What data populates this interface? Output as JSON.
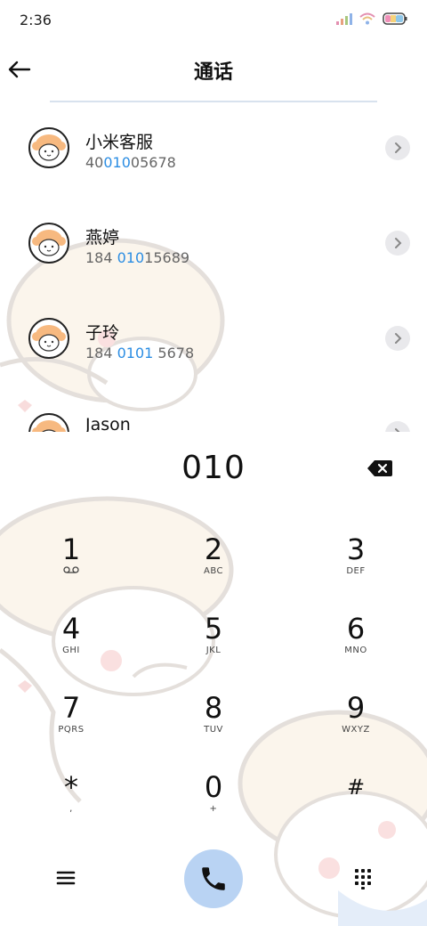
{
  "status_bar": {
    "time": "2:36"
  },
  "header": {
    "title": "通话"
  },
  "contacts": [
    {
      "name": "小米客服",
      "number_parts": [
        "40",
        "010",
        "05678"
      ]
    },
    {
      "name": "燕婷",
      "number_parts": [
        "184 ",
        "010",
        "15689"
      ]
    },
    {
      "name": "子玲",
      "number_parts": [
        "184 ",
        "0101",
        " 5678"
      ]
    },
    {
      "name": "Jason",
      "number_parts": [
        "",
        "",
        ""
      ]
    }
  ],
  "dialer": {
    "input": "010",
    "keys": [
      {
        "digit": "1",
        "sub": "voicemail"
      },
      {
        "digit": "2",
        "sub": "ABC"
      },
      {
        "digit": "3",
        "sub": "DEF"
      },
      {
        "digit": "4",
        "sub": "GHI"
      },
      {
        "digit": "5",
        "sub": "JKL"
      },
      {
        "digit": "6",
        "sub": "MNO"
      },
      {
        "digit": "7",
        "sub": "PQRS"
      },
      {
        "digit": "8",
        "sub": "TUV"
      },
      {
        "digit": "9",
        "sub": "WXYZ"
      },
      {
        "digit": "*",
        "sub": ","
      },
      {
        "digit": "0",
        "sub": "+"
      },
      {
        "digit": "#",
        "sub": ""
      }
    ]
  },
  "colors": {
    "highlight": "#2b8de3",
    "call_button": "#b9d3f3"
  }
}
